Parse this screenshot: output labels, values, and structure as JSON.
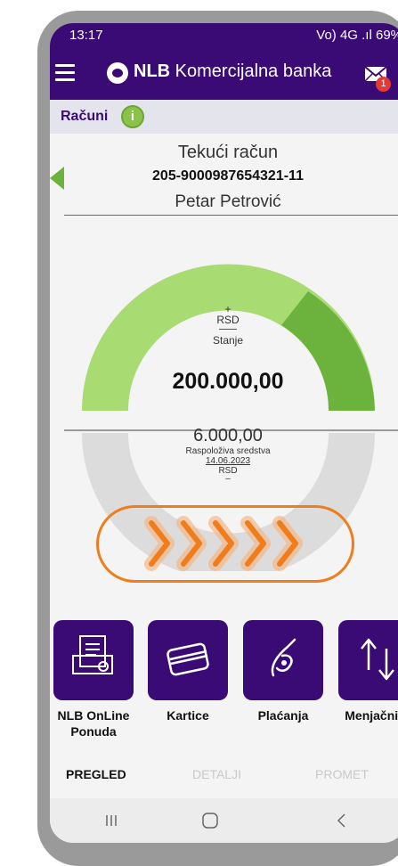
{
  "status_bar": {
    "time": "13:17",
    "indicators": "Vo) 4G .ıl 69%"
  },
  "app_bar": {
    "brand_bold": "NLB",
    "brand_rest": "Komercijalna banka",
    "mail_badge_count": "1"
  },
  "section": {
    "title": "Računi"
  },
  "account": {
    "type": "Tekući račun",
    "number": "205-9000987654321-11",
    "holder": "Petar Petrović"
  },
  "balance": {
    "plus": "+",
    "currency_top": "RSD",
    "label": "Stanje",
    "amount": "200.000,00",
    "available_amount": "6.000,00",
    "available_label": "Raspoloživa sredstva",
    "available_date": "14.06.2023",
    "currency_bottom": "RSD",
    "minus": "–"
  },
  "actions": [
    {
      "label": "NLB OnLine Ponuda",
      "icon": "online-offer-icon"
    },
    {
      "label": "Kartice",
      "icon": "card-icon"
    },
    {
      "label": "Plaćanja",
      "icon": "payment-icon"
    },
    {
      "label": "Menjačnica",
      "icon": "exchange-icon"
    }
  ],
  "tabs": [
    {
      "label": "PREGLED",
      "active": true
    },
    {
      "label": "DETALJI",
      "active": false
    },
    {
      "label": "PROMET",
      "active": false
    }
  ],
  "colors": {
    "brand": "#3a0b74",
    "gauge_light": "#a9db73",
    "gauge_dark": "#6cb33e",
    "swipe": "#f07d1c",
    "info": "#8bc34a"
  }
}
